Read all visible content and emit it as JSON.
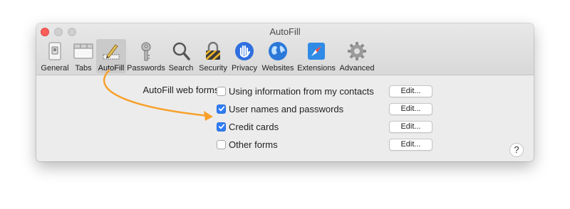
{
  "window": {
    "title": "AutoFill"
  },
  "toolbar": {
    "tabs": [
      {
        "label": "General",
        "icon": "general-switch-icon",
        "selected": false
      },
      {
        "label": "Tabs",
        "icon": "tabs-icon",
        "selected": false
      },
      {
        "label": "AutoFill",
        "icon": "pencil-autofill-icon",
        "selected": true
      },
      {
        "label": "Passwords",
        "icon": "key-icon",
        "selected": false
      },
      {
        "label": "Search",
        "icon": "magnifier-icon",
        "selected": false
      },
      {
        "label": "Security",
        "icon": "padlock-icon",
        "selected": false
      },
      {
        "label": "Privacy",
        "icon": "hand-icon",
        "selected": false
      },
      {
        "label": "Websites",
        "icon": "globe-icon",
        "selected": false
      },
      {
        "label": "Extensions",
        "icon": "puzzle-compass-icon",
        "selected": false
      },
      {
        "label": "Advanced",
        "icon": "gear-icon",
        "selected": false
      }
    ]
  },
  "autofill": {
    "section_label": "AutoFill web forms:",
    "options": [
      {
        "label": "Using information from my contacts",
        "checked": false,
        "button": "Edit..."
      },
      {
        "label": "User names and passwords",
        "checked": true,
        "button": "Edit..."
      },
      {
        "label": "Credit cards",
        "checked": true,
        "button": "Edit..."
      },
      {
        "label": "Other forms",
        "checked": false,
        "button": "Edit..."
      }
    ]
  },
  "help": {
    "label": "?"
  },
  "colors": {
    "accent": "#2f7df6",
    "arrow": "#f7a12b"
  }
}
